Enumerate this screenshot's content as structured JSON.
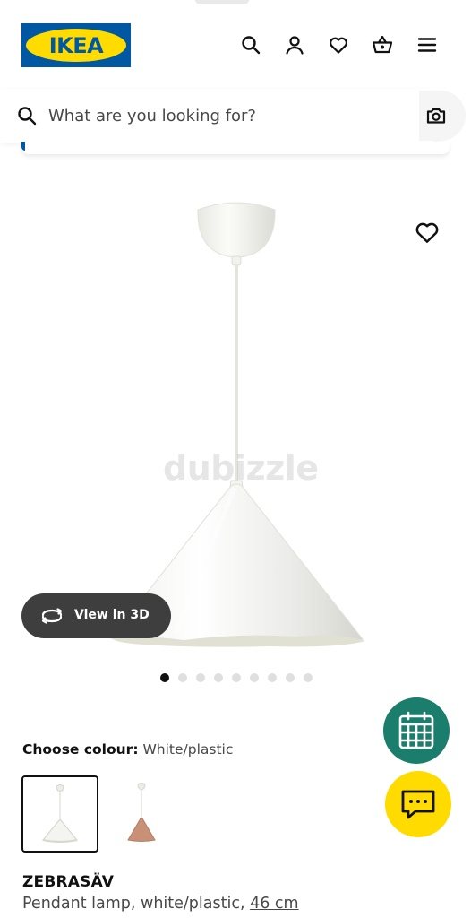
{
  "header": {
    "logo_text": "IKEA",
    "icons": [
      "search-icon",
      "user-icon",
      "heart-icon",
      "basket-icon",
      "menu-icon"
    ]
  },
  "search": {
    "placeholder": "What are you looking for?",
    "icon": "search-icon",
    "camera_icon": "camera-icon"
  },
  "gallery": {
    "watermark": "dubizzle",
    "view_3d_label": "View in 3D",
    "dots_count": 9,
    "active_dot": 0
  },
  "colour": {
    "label": "Choose colour:",
    "value": "White/plastic",
    "options": [
      "white-lamp",
      "copper-lamp"
    ],
    "selected": 0
  },
  "product": {
    "name": "ZEBRASÄV",
    "description": "Pendant lamp, white/plastic,",
    "size": "46 cm"
  },
  "fabs": {
    "calendar_icon": "calendar-icon",
    "chat_icon": "chat-icon",
    "calendar_color": "#1b7d6b",
    "chat_color": "#ffdb00"
  },
  "colors": {
    "brand_blue": "#0058a3",
    "brand_yellow": "#ffdb00",
    "text_dark": "#111111",
    "text_muted": "#484848"
  }
}
